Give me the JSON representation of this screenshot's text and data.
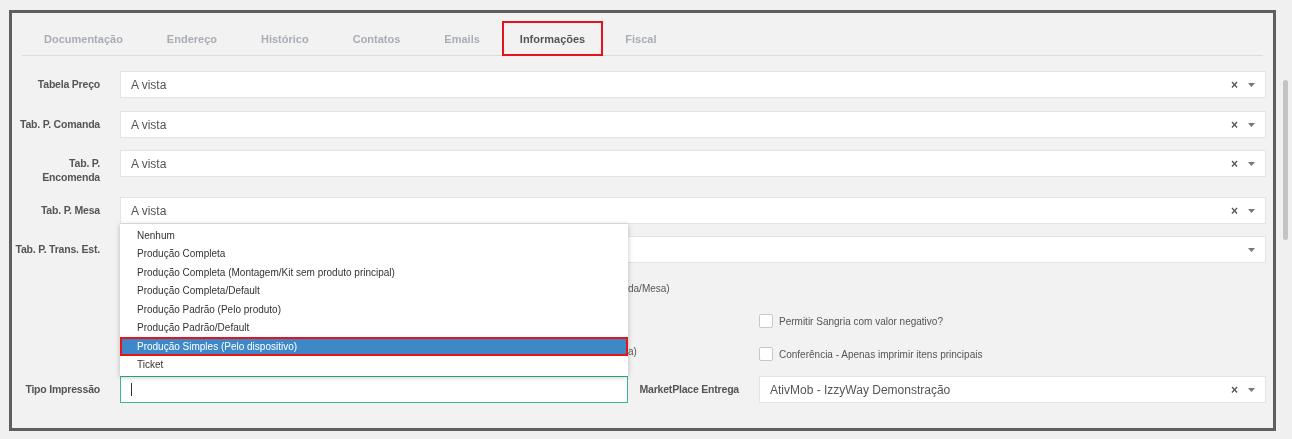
{
  "tabs": [
    {
      "label": "Documentação",
      "selected": false
    },
    {
      "label": "Endereço",
      "selected": false
    },
    {
      "label": "Histórico",
      "selected": false
    },
    {
      "label": "Contatos",
      "selected": false
    },
    {
      "label": "Emails",
      "selected": false
    },
    {
      "label": "Informações",
      "selected": true
    },
    {
      "label": "Fiscal",
      "selected": false
    }
  ],
  "fields": [
    {
      "label": "Tabela Preço",
      "value": "A vista",
      "clear": "×"
    },
    {
      "label": "Tab. P. Comanda",
      "value": "A vista",
      "clear": "×"
    },
    {
      "label": "Tab. P. Encomenda",
      "value": "A vista",
      "clear": "×"
    },
    {
      "label": "Tab. P. Mesa",
      "value": "A vista",
      "clear": "×"
    },
    {
      "label": "Tab. P. Trans. Est."
    }
  ],
  "covered_texts": [
    "da/Mesa)",
    "a)"
  ],
  "checkboxes": [
    {
      "label": "Permitir Sangria com valor negativo?",
      "checked": false
    },
    {
      "label": "Conferência - Apenas imprimir itens principais",
      "checked": false
    }
  ],
  "tipo_impressao": {
    "label": "Tipo Impressão",
    "focused": true,
    "options": [
      {
        "label": "Nenhum",
        "selected": false
      },
      {
        "label": "Produção Completa",
        "selected": false
      },
      {
        "label": "Produção Completa (Montagem/Kit sem produto principal)",
        "selected": false
      },
      {
        "label": "Produção Completa/Default",
        "selected": false
      },
      {
        "label": "Produção Padrão (Pelo produto)",
        "selected": false
      },
      {
        "label": "Produção Padrão/Default",
        "selected": false
      },
      {
        "label": "Produção Simples (Pelo dispositivo)",
        "selected": true
      },
      {
        "label": "Ticket",
        "selected": false
      }
    ]
  },
  "marketplace": {
    "label": "MarketPlace Entrega",
    "value": "AtivMob - IzzyWay Demonstração",
    "clear": "×"
  }
}
